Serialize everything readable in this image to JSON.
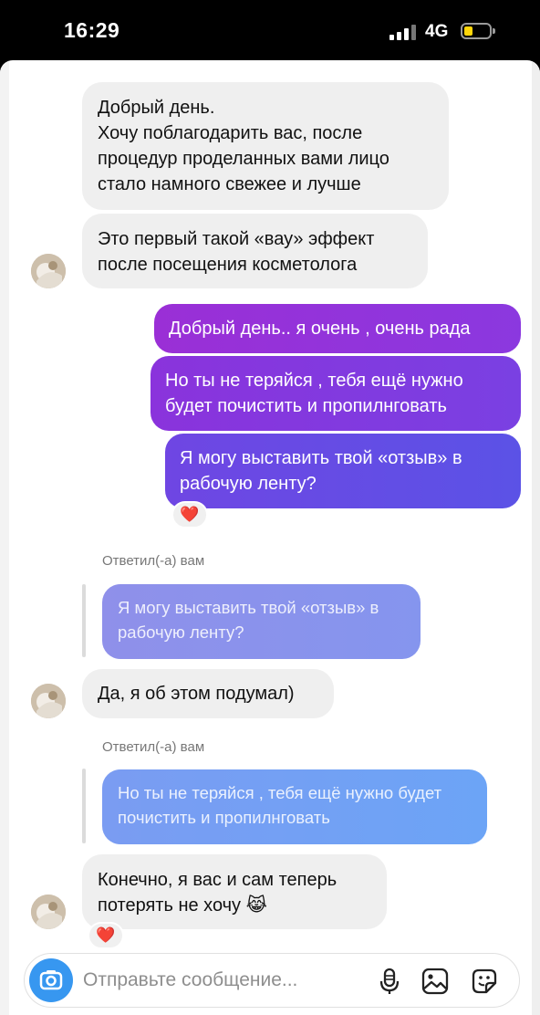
{
  "status_bar": {
    "time": "16:29",
    "network": "4G"
  },
  "messages": [
    {
      "id": "m1",
      "side": "in",
      "text": "Добрый день.\nХочу поблагодарить вас, после процедур проделанных вами лицо стало намного свежее и лучше"
    },
    {
      "id": "m2",
      "side": "in",
      "text": "Это первый такой «вау» эффект после посещения косметолога"
    },
    {
      "id": "m3",
      "side": "out",
      "text": "Добрый день.. я очень , очень рада"
    },
    {
      "id": "m4",
      "side": "out",
      "text": "Но ты не теряйся , тебя ещё нужно будет почистить и пропилнговать"
    },
    {
      "id": "m5",
      "side": "out",
      "text": "Я могу выставить твой «отзыв» в рабочую ленту?",
      "reaction": "❤️"
    },
    {
      "id": "m6",
      "side": "in",
      "reply_label": "Ответил(-а) вам",
      "quote": "Я могу выставить твой «отзыв» в рабочую ленту?",
      "text": "Да, я об этом подумал)"
    },
    {
      "id": "m7",
      "side": "in",
      "reply_label": "Ответил(-а) вам",
      "quote": "Но ты не теряйся , тебя ещё нужно будет почистить и пропилнговать",
      "text": "Конечно, я вас и сам теперь потерять не хочу 😹",
      "reaction": "❤️"
    }
  ],
  "composer": {
    "placeholder": "Отправьте сообщение...",
    "icons": [
      "camera-icon",
      "microphone-icon",
      "gallery-icon",
      "sticker-icon"
    ],
    "accent_color": "#3797f0"
  },
  "colors": {
    "incoming_bubble": "#efefef",
    "outgoing_gradient": [
      "#a02fd4",
      "#5b52e6"
    ],
    "quote_gradient": [
      "#8d91ea",
      "#6f9ef4"
    ]
  }
}
